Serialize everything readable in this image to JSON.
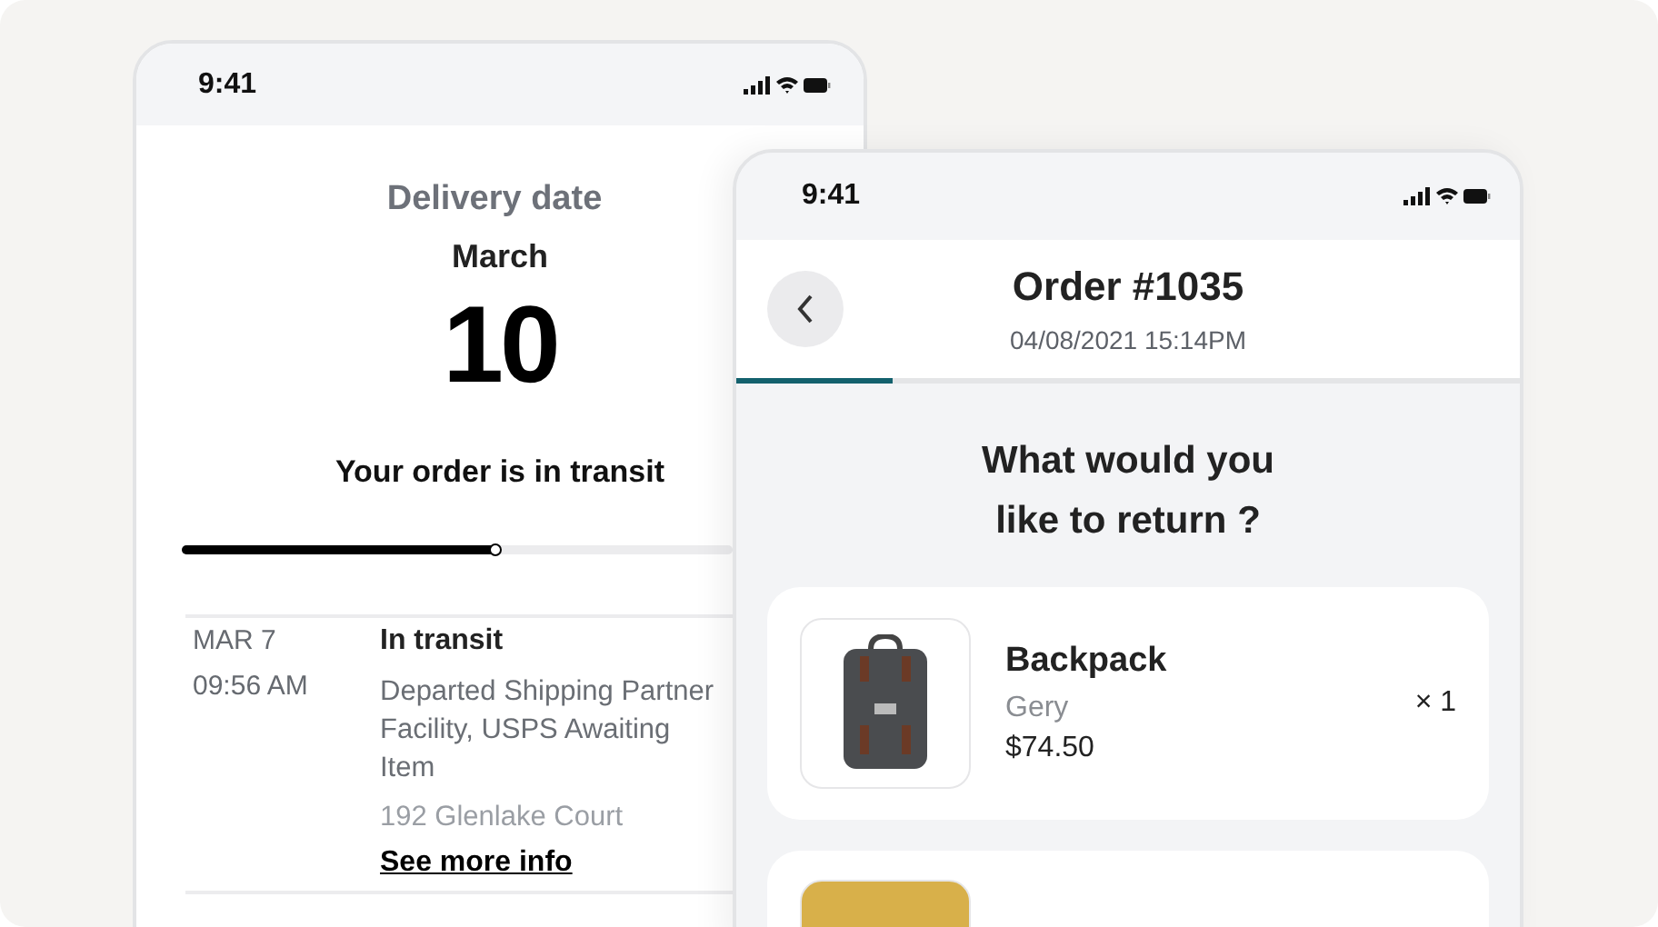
{
  "tracking_phone": {
    "status_bar": {
      "time": "9:41"
    },
    "delivery_label": "Delivery date",
    "month": "March",
    "day": "10",
    "status_text": "Your order is in transit",
    "progress": {
      "level": 0.57
    },
    "events": [
      {
        "date": "MAR 7",
        "time": "09:56 AM",
        "title": "In transit",
        "description": "Departed Shipping Partner Facility, USPS Awaiting Item",
        "location": "192 Glenlake Court",
        "link": "See more info"
      }
    ]
  },
  "return_phone": {
    "status_bar": {
      "time": "9:41"
    },
    "order_title": "Order #1035",
    "order_date": "04/08/2021 15:14PM",
    "step_progress": {
      "level": 0.2
    },
    "question": "What would you like to return ?",
    "items": [
      {
        "name": "Backpack",
        "variant": "Gery",
        "price": "$74.50",
        "quantity": "× 1"
      }
    ]
  }
}
